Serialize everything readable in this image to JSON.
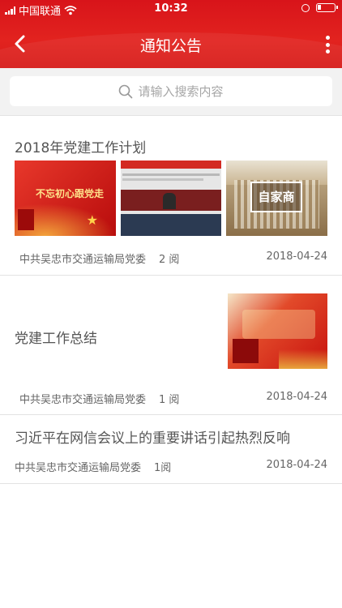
{
  "status_bar": {
    "carrier": "中国联通",
    "time": "10:32"
  },
  "header": {
    "title": "通知公告"
  },
  "search": {
    "placeholder": "请输入搜索内容"
  },
  "news": [
    {
      "title": "2018年党建工作计划",
      "source": "中共吴忠市交通运输局党委",
      "reads": "2 阅",
      "date": "2018-04-24",
      "thumb_texts": [
        "不忘初心跟党走",
        "自家商"
      ]
    },
    {
      "title": "党建工作总结",
      "source": "中共吴忠市交通运输局党委",
      "reads": "1 阅",
      "date": "2018-04-24"
    },
    {
      "title": "习近平在网信会议上的重要讲话引起热烈反响",
      "source": "中共吴忠市交通运输局党委",
      "reads": "1阅",
      "date": "2018-04-24"
    }
  ],
  "colors": {
    "brand_red": "#e2231f",
    "text": "#555555",
    "meta": "#666666"
  }
}
